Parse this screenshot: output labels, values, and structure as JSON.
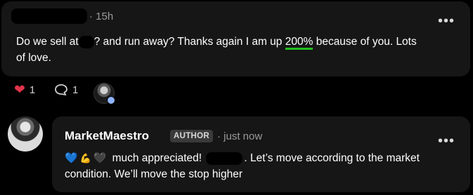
{
  "post": {
    "time_ago": "15h",
    "text_part1": "Do we sell at",
    "text_part2": "? and run away? Thanks again I am up ",
    "highlight": "200%",
    "text_part3": " because of you. Lots",
    "text_part4": "of love.",
    "likes": "1",
    "comments": "1"
  },
  "reply": {
    "author": "MarketMaestro",
    "badge": "AUTHOR",
    "separator": "·",
    "time_ago": "just now",
    "emojis": [
      "💙",
      "💪",
      "🖤"
    ],
    "text_part1": "much appreciated!",
    "text_part2": ". Let’s move according to the market",
    "text_part3": "condition. We’ll move the stop higher"
  },
  "menu_glyph": "•••",
  "icons": {
    "like": "heart-icon",
    "comment": "comment-icon",
    "more": "more-icon"
  },
  "colors": {
    "background": "#000000",
    "card": "#161616",
    "like": "#e2344b",
    "highlight_underline": "#22c01e"
  }
}
